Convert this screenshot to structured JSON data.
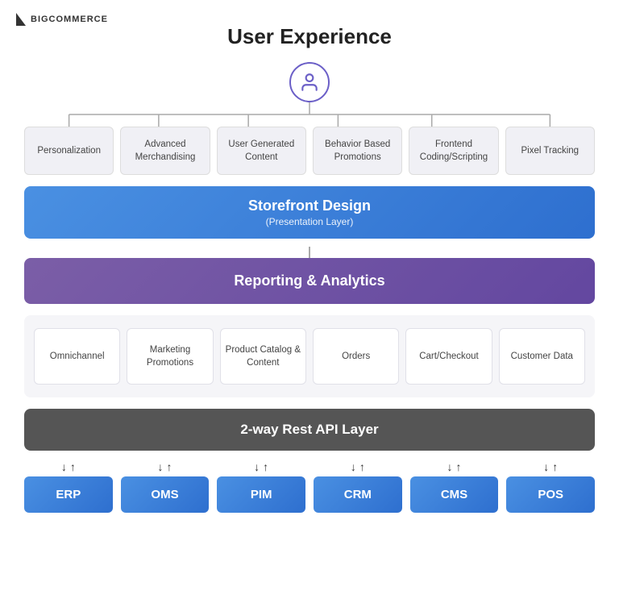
{
  "logo": {
    "text": "BIGCOMMERCE"
  },
  "header": {
    "title": "User Experience"
  },
  "top_boxes": [
    {
      "id": "personalization",
      "label": "Personalization"
    },
    {
      "id": "advanced-merchandising",
      "label": "Advanced Merchandising"
    },
    {
      "id": "user-generated-content",
      "label": "User Generated Content"
    },
    {
      "id": "behavior-based-promotions",
      "label": "Behavior Based Promotions"
    },
    {
      "id": "frontend-coding-scripting",
      "label": "Frontend Coding/Scripting"
    },
    {
      "id": "pixel-tracking",
      "label": "Pixel Tracking"
    }
  ],
  "storefront_bar": {
    "title": "Storefront Design",
    "subtitle": "(Presentation Layer)"
  },
  "reporting_bar": {
    "title": "Reporting & Analytics"
  },
  "middle_boxes": [
    {
      "id": "omnichannel",
      "label": "Omnichannel"
    },
    {
      "id": "marketing-promotions",
      "label": "Marketing Promotions"
    },
    {
      "id": "product-catalog-content",
      "label": "Product Catalog & Content"
    },
    {
      "id": "orders",
      "label": "Orders"
    },
    {
      "id": "cart-checkout",
      "label": "Cart/Checkout"
    },
    {
      "id": "customer-data",
      "label": "Customer Data"
    }
  ],
  "api_bar": {
    "title": "2-way Rest API Layer"
  },
  "integrations": [
    {
      "id": "erp",
      "label": "ERP"
    },
    {
      "id": "oms",
      "label": "OMS"
    },
    {
      "id": "pim",
      "label": "PIM"
    },
    {
      "id": "crm",
      "label": "CRM"
    },
    {
      "id": "cms",
      "label": "CMS"
    },
    {
      "id": "pos",
      "label": "POS"
    }
  ],
  "arrow_down": "↓",
  "arrow_up": "↑"
}
